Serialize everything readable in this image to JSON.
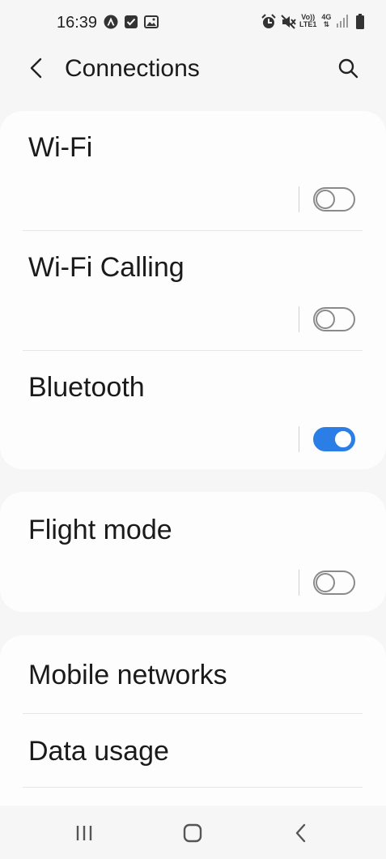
{
  "status": {
    "time": "16:39",
    "volte": "Vo))",
    "lte": "LTE1",
    "network": "4G"
  },
  "header": {
    "title": "Connections"
  },
  "settings": [
    {
      "label": "Wi-Fi",
      "enabled": false
    },
    {
      "label": "Wi-Fi Calling",
      "enabled": false
    },
    {
      "label": "Bluetooth",
      "enabled": true
    },
    {
      "label": "Flight mode",
      "enabled": false
    }
  ],
  "links": [
    {
      "label": "Mobile networks"
    },
    {
      "label": "Data usage"
    }
  ],
  "colors": {
    "accent": "#2a7ee6",
    "card": "#fdfdfd",
    "background": "#f6f6f6"
  }
}
